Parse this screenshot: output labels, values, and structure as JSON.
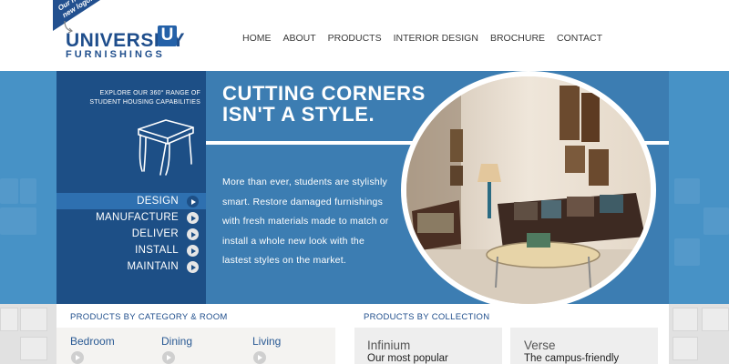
{
  "logo": {
    "ribbon": "Our new\nnew logo!",
    "line1": "UNIVERSITY",
    "badge": "U",
    "line2": "FURNISHINGS"
  },
  "nav": [
    "HOME",
    "ABOUT",
    "PRODUCTS",
    "INTERIOR DESIGN",
    "BROCHURE",
    "CONTACT"
  ],
  "hero": {
    "tagline": [
      "EXPLORE OUR 360° RANGE OF",
      "STUDENT HOUSING CAPABILITIES"
    ],
    "menu": [
      "DESIGN",
      "MANUFACTURE",
      "DELIVER",
      "INSTALL",
      "MAINTAIN"
    ],
    "active_index": 0,
    "headline": [
      "CUTTING CORNERS",
      "ISN'T A STYLE."
    ],
    "body": [
      "More than ever, students are stylishly",
      "smart. Restore damaged furnishings",
      "with fresh materials made to match or",
      "install a whole new look with the",
      "lastest styles on the market."
    ]
  },
  "categories": {
    "heading": "PRODUCTS BY CATEGORY & ROOM",
    "items": [
      "Bedroom",
      "Dining",
      "Living"
    ]
  },
  "collections": {
    "heading": "PRODUCTS BY COLLECTION",
    "items": [
      {
        "name": "Infinium",
        "desc": "Our most popular"
      },
      {
        "name": "Verse",
        "desc": "The campus-friendly"
      }
    ]
  },
  "colors": {
    "brand_navy": "#1d4f86",
    "hero_blue": "#3c7db2",
    "band_blue": "#4792c6",
    "logo_blue": "#1f4e8c"
  },
  "icons": [
    "stool-line-icon",
    "play-circle-icon",
    "new-logo-arrow-icon"
  ]
}
